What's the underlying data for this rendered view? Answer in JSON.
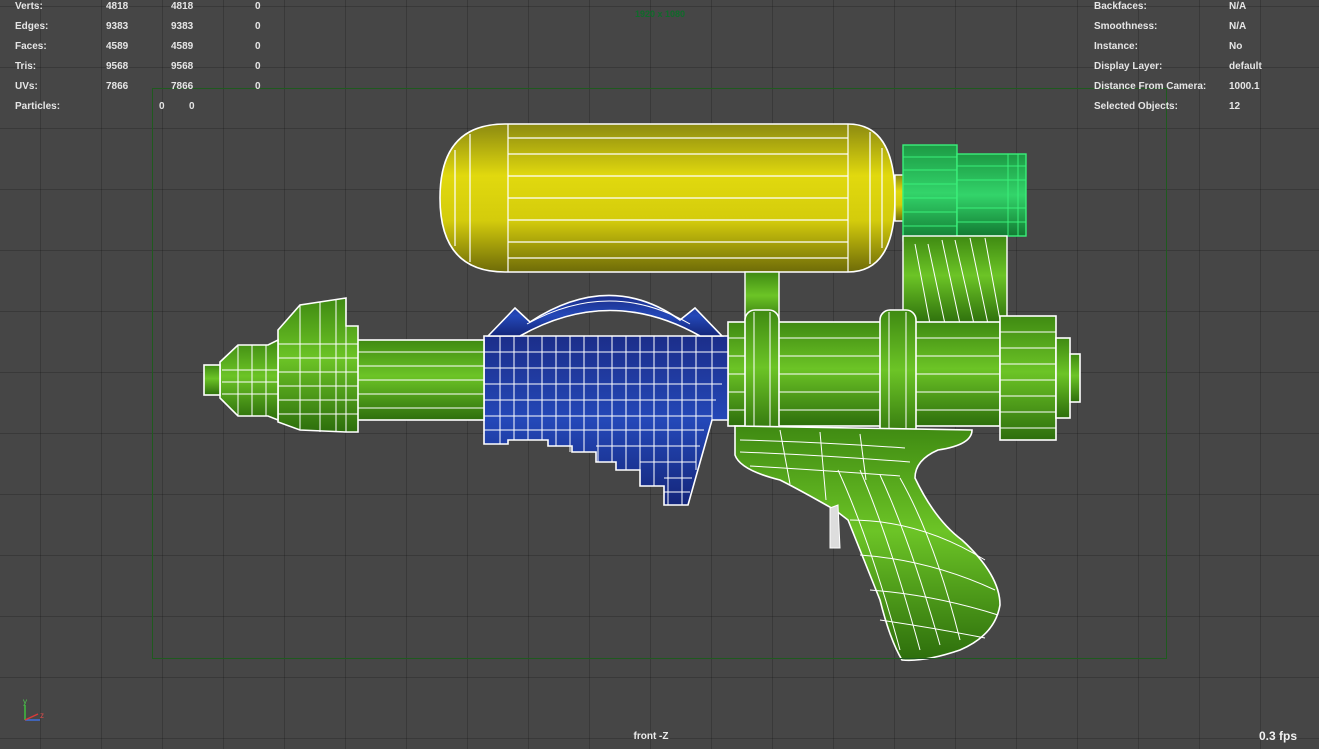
{
  "stats_left": {
    "rows": [
      {
        "label": "Verts:",
        "a": "4818",
        "b": "4818",
        "c": "0"
      },
      {
        "label": "Edges:",
        "a": "9383",
        "b": "9383",
        "c": "0"
      },
      {
        "label": "Faces:",
        "a": "4589",
        "b": "4589",
        "c": "0"
      },
      {
        "label": "Tris:",
        "a": "9568",
        "b": "9568",
        "c": "0"
      },
      {
        "label": "UVs:",
        "a": "7866",
        "b": "7866",
        "c": "0"
      }
    ],
    "particles": {
      "label": "Particles:",
      "a": "0",
      "b": "0"
    }
  },
  "stats_right": {
    "rows": [
      {
        "label": "Backfaces:",
        "value": "N/A"
      },
      {
        "label": "Smoothness:",
        "value": "N/A"
      },
      {
        "label": "Instance:",
        "value": "No"
      },
      {
        "label": "Display Layer:",
        "value": "default"
      },
      {
        "label": "Distance From Camera:",
        "value": "1000.1"
      },
      {
        "label": "Selected Objects:",
        "value": "12"
      }
    ]
  },
  "resolution_label": "1920 x 1080",
  "camera_label": "front -Z",
  "fps_label": "0.3 fps",
  "axis_labels": {
    "y": "y",
    "z": "z"
  },
  "colors": {
    "background": "#464646",
    "tank": "#d4cc0c",
    "body_green": "#5ab41c",
    "cap_green": "#26c25a",
    "pump_blue": "#1a3da0",
    "wire": "#ffffff",
    "resolution_gate": "#1f5a1f"
  }
}
